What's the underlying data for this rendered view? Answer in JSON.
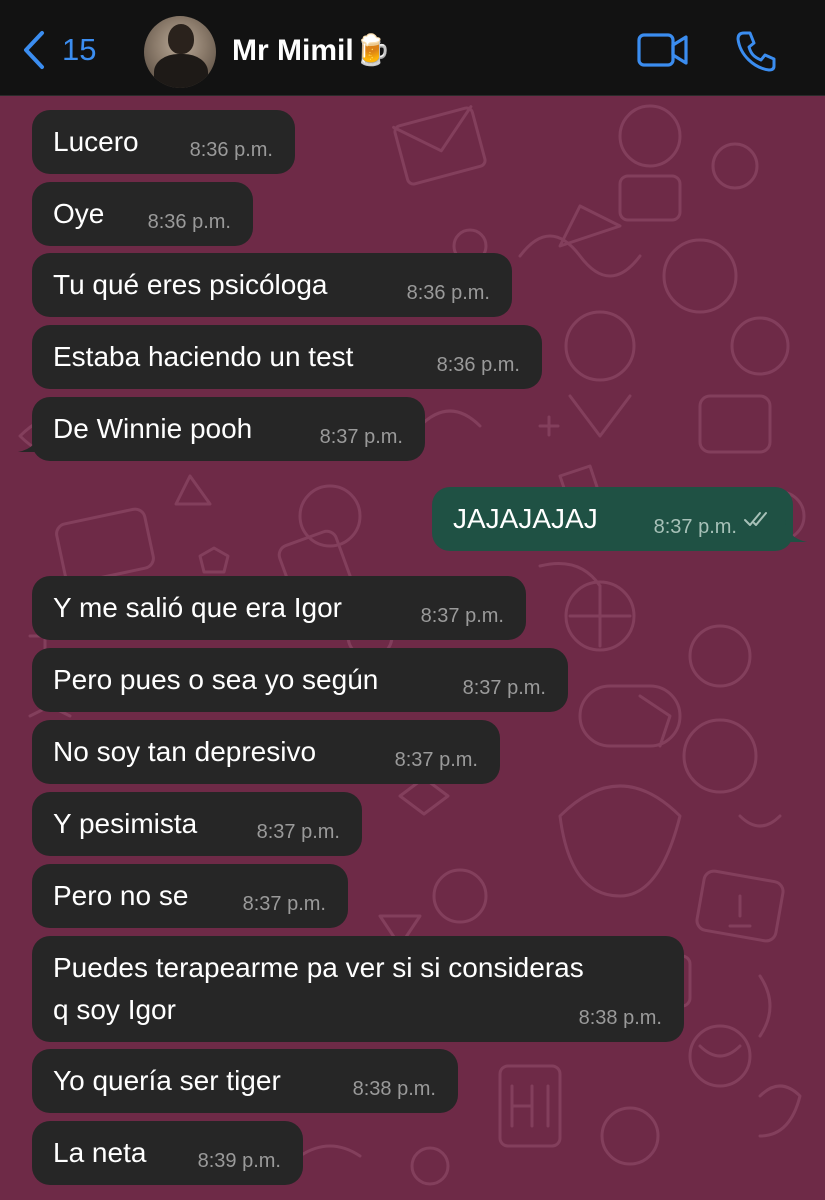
{
  "header": {
    "back_count": "15",
    "contact_name": "Mr Mimil🍺",
    "accent_color": "#3b8df0"
  },
  "messages": [
    {
      "direction": "in",
      "text": "Lucero",
      "time": "8:36 p.m."
    },
    {
      "direction": "in",
      "text": "Oye",
      "time": "8:36 p.m."
    },
    {
      "direction": "in",
      "text": "Tu qué eres psicóloga",
      "time": "8:36 p.m."
    },
    {
      "direction": "in",
      "text": "Estaba haciendo un test",
      "time": "8:36 p.m."
    },
    {
      "direction": "in",
      "text": "De Winnie pooh",
      "time": "8:37 p.m."
    },
    {
      "direction": "out",
      "text": "JAJAJAJAJ",
      "time": "8:37 p.m.",
      "status": "read"
    },
    {
      "direction": "in",
      "text": "Y me salió que era Igor",
      "time": "8:37 p.m."
    },
    {
      "direction": "in",
      "text": "Pero pues o sea yo según",
      "time": "8:37 p.m."
    },
    {
      "direction": "in",
      "text": "No soy tan depresivo",
      "time": "8:37 p.m."
    },
    {
      "direction": "in",
      "text": "Y pesimista",
      "time": "8:37 p.m."
    },
    {
      "direction": "in",
      "text": "Pero no se",
      "time": "8:37 p.m."
    },
    {
      "direction": "in",
      "text": "Puedes terapearme pa ver si si consideras",
      "text2": "q soy Igor",
      "time": "8:38 p.m."
    },
    {
      "direction": "in",
      "text": "Yo quería ser tiger",
      "time": "8:38 p.m."
    },
    {
      "direction": "in",
      "text": "La neta",
      "time": "8:39 p.m."
    }
  ],
  "colors": {
    "wallpaper": "#6e2a47",
    "incoming_bubble": "#262626",
    "outgoing_bubble": "#1f5144",
    "header_bg": "#121212"
  },
  "icons": {
    "back": "chevron-left-icon",
    "video": "video-camera-icon",
    "call": "phone-icon",
    "read_status": "double-check-icon"
  }
}
